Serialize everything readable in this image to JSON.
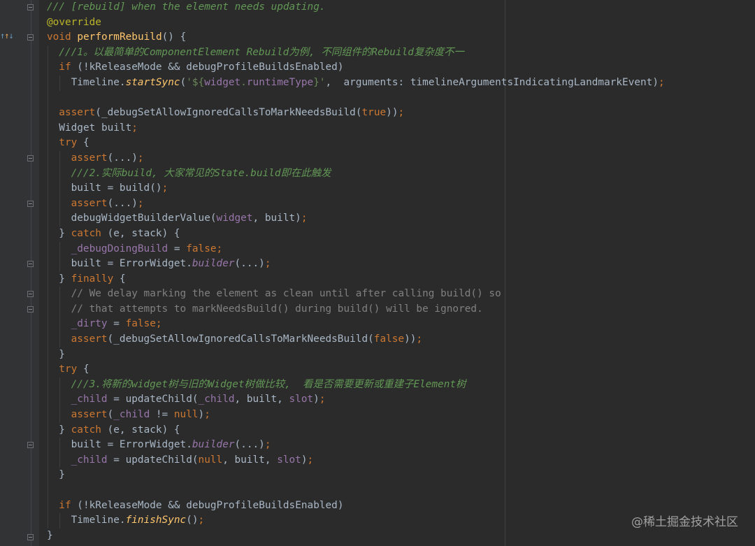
{
  "editor": {
    "language": "dart",
    "theme_colors": {
      "background": "#2b2b2b",
      "keyword": "#cc7832",
      "function": "#ffc66d",
      "property": "#9876aa",
      "string": "#6a8759",
      "comment": "#808080",
      "doc_comment": "#629755",
      "annotation": "#bbb529",
      "default": "#a9b7c6"
    },
    "lines": [
      {
        "indent": 0,
        "tokens": [
          {
            "t": "/// [rebuild] when the element needs updating.",
            "c": "doc"
          }
        ]
      },
      {
        "indent": 0,
        "tokens": [
          {
            "t": "@override",
            "c": "an"
          }
        ]
      },
      {
        "indent": 0,
        "tokens": [
          {
            "t": "void ",
            "c": "kw"
          },
          {
            "t": "performRebuild",
            "c": "fn"
          },
          {
            "t": "() {",
            "c": ""
          }
        ]
      },
      {
        "indent": 1,
        "tokens": [
          {
            "t": "///1。以最简单的ComponentElement Rebuild为例, 不同组件的Rebuild复杂度不一",
            "c": "doc"
          }
        ]
      },
      {
        "indent": 1,
        "tokens": [
          {
            "t": "if ",
            "c": "kw"
          },
          {
            "t": "(!kReleaseMode && debugProfileBuildsEnabled)",
            "c": ""
          }
        ]
      },
      {
        "indent": 2,
        "tokens": [
          {
            "t": "Timeline.",
            "c": ""
          },
          {
            "t": "startSync",
            "c": "it"
          },
          {
            "t": "(",
            "c": ""
          },
          {
            "t": "'${",
            "c": "st"
          },
          {
            "t": "widget",
            "c": "pr"
          },
          {
            "t": ".",
            "c": "st"
          },
          {
            "t": "runtimeType",
            "c": "pr"
          },
          {
            "t": "}'",
            "c": "st"
          },
          {
            "t": ",  arguments: timelineArgumentsIndicatingLandmarkEvent)",
            "c": ""
          },
          {
            "t": ";",
            "c": "kw"
          }
        ]
      },
      {
        "indent": 1,
        "tokens": []
      },
      {
        "indent": 1,
        "tokens": [
          {
            "t": "assert",
            "c": "kw"
          },
          {
            "t": "(_debugSetAllowIgnoredCallsToMarkNeedsBuild(",
            "c": ""
          },
          {
            "t": "true",
            "c": "kw"
          },
          {
            "t": "))",
            "c": ""
          },
          {
            "t": ";",
            "c": "kw"
          }
        ]
      },
      {
        "indent": 1,
        "tokens": [
          {
            "t": "Widget built",
            "c": ""
          },
          {
            "t": ";",
            "c": "kw"
          }
        ]
      },
      {
        "indent": 1,
        "tokens": [
          {
            "t": "try ",
            "c": "kw"
          },
          {
            "t": "{",
            "c": ""
          }
        ]
      },
      {
        "indent": 2,
        "tokens": [
          {
            "t": "assert",
            "c": "kw"
          },
          {
            "t": "(...)",
            "c": ""
          },
          {
            "t": ";",
            "c": "kw"
          }
        ]
      },
      {
        "indent": 2,
        "tokens": [
          {
            "t": "///2.实际build, 大家常见的State.build即在此触发",
            "c": "doc"
          }
        ]
      },
      {
        "indent": 2,
        "tokens": [
          {
            "t": "built = build()",
            "c": ""
          },
          {
            "t": ";",
            "c": "kw"
          }
        ]
      },
      {
        "indent": 2,
        "tokens": [
          {
            "t": "assert",
            "c": "kw"
          },
          {
            "t": "(...)",
            "c": ""
          },
          {
            "t": ";",
            "c": "kw"
          }
        ]
      },
      {
        "indent": 2,
        "tokens": [
          {
            "t": "debugWidgetBuilderValue(",
            "c": ""
          },
          {
            "t": "widget",
            "c": "pr"
          },
          {
            "t": ", built)",
            "c": ""
          },
          {
            "t": ";",
            "c": "kw"
          }
        ]
      },
      {
        "indent": 1,
        "tokens": [
          {
            "t": "} ",
            "c": ""
          },
          {
            "t": "catch ",
            "c": "kw"
          },
          {
            "t": "(e, stack) {",
            "c": ""
          }
        ]
      },
      {
        "indent": 2,
        "tokens": [
          {
            "t": "_debugDoingBuild",
            "c": "pr"
          },
          {
            "t": " = ",
            "c": ""
          },
          {
            "t": "false",
            "c": "kw"
          },
          {
            "t": ";",
            "c": "kw"
          }
        ]
      },
      {
        "indent": 2,
        "tokens": [
          {
            "t": "built = ErrorWidget.",
            "c": ""
          },
          {
            "t": "builder",
            "c": "pi"
          },
          {
            "t": "(...)",
            "c": ""
          },
          {
            "t": ";",
            "c": "kw"
          }
        ]
      },
      {
        "indent": 1,
        "tokens": [
          {
            "t": "} ",
            "c": ""
          },
          {
            "t": "finally ",
            "c": "kw"
          },
          {
            "t": "{",
            "c": ""
          }
        ]
      },
      {
        "indent": 2,
        "tokens": [
          {
            "t": "// We delay marking the element as clean until after calling build() so",
            "c": "cm"
          }
        ]
      },
      {
        "indent": 2,
        "tokens": [
          {
            "t": "// that attempts to markNeedsBuild() during build() will be ignored.",
            "c": "cm"
          }
        ]
      },
      {
        "indent": 2,
        "tokens": [
          {
            "t": "_dirty",
            "c": "pr"
          },
          {
            "t": " = ",
            "c": ""
          },
          {
            "t": "false",
            "c": "kw"
          },
          {
            "t": ";",
            "c": "kw"
          }
        ]
      },
      {
        "indent": 2,
        "tokens": [
          {
            "t": "assert",
            "c": "kw"
          },
          {
            "t": "(_debugSetAllowIgnoredCallsToMarkNeedsBuild(",
            "c": ""
          },
          {
            "t": "false",
            "c": "kw"
          },
          {
            "t": "))",
            "c": ""
          },
          {
            "t": ";",
            "c": "kw"
          }
        ]
      },
      {
        "indent": 1,
        "tokens": [
          {
            "t": "}",
            "c": ""
          }
        ]
      },
      {
        "indent": 1,
        "tokens": [
          {
            "t": "try ",
            "c": "kw"
          },
          {
            "t": "{",
            "c": ""
          }
        ]
      },
      {
        "indent": 2,
        "tokens": [
          {
            "t": "///3.将新的widget树与旧的Widget树做比较,  看是否需要更新或重建子Element树",
            "c": "doc"
          }
        ]
      },
      {
        "indent": 2,
        "tokens": [
          {
            "t": "_child",
            "c": "pr"
          },
          {
            "t": " = updateChild(",
            "c": ""
          },
          {
            "t": "_child",
            "c": "pr"
          },
          {
            "t": ", built, ",
            "c": ""
          },
          {
            "t": "slot",
            "c": "pr"
          },
          {
            "t": ")",
            "c": ""
          },
          {
            "t": ";",
            "c": "kw"
          }
        ]
      },
      {
        "indent": 2,
        "tokens": [
          {
            "t": "assert",
            "c": "kw"
          },
          {
            "t": "(",
            "c": ""
          },
          {
            "t": "_child",
            "c": "pr"
          },
          {
            "t": " != ",
            "c": ""
          },
          {
            "t": "null",
            "c": "kw"
          },
          {
            "t": ")",
            "c": ""
          },
          {
            "t": ";",
            "c": "kw"
          }
        ]
      },
      {
        "indent": 1,
        "tokens": [
          {
            "t": "} ",
            "c": ""
          },
          {
            "t": "catch ",
            "c": "kw"
          },
          {
            "t": "(e, stack) {",
            "c": ""
          }
        ]
      },
      {
        "indent": 2,
        "tokens": [
          {
            "t": "built = ErrorWidget.",
            "c": ""
          },
          {
            "t": "builder",
            "c": "pi"
          },
          {
            "t": "(...)",
            "c": ""
          },
          {
            "t": ";",
            "c": "kw"
          }
        ]
      },
      {
        "indent": 2,
        "tokens": [
          {
            "t": "_child",
            "c": "pr"
          },
          {
            "t": " = updateChild(",
            "c": ""
          },
          {
            "t": "null",
            "c": "kw"
          },
          {
            "t": ", built, ",
            "c": ""
          },
          {
            "t": "slot",
            "c": "pr"
          },
          {
            "t": ")",
            "c": ""
          },
          {
            "t": ";",
            "c": "kw"
          }
        ]
      },
      {
        "indent": 1,
        "tokens": [
          {
            "t": "}",
            "c": ""
          }
        ]
      },
      {
        "indent": 1,
        "tokens": []
      },
      {
        "indent": 1,
        "tokens": [
          {
            "t": "if ",
            "c": "kw"
          },
          {
            "t": "(!kReleaseMode && debugProfileBuildsEnabled)",
            "c": ""
          }
        ]
      },
      {
        "indent": 2,
        "tokens": [
          {
            "t": "Timeline.",
            "c": ""
          },
          {
            "t": "finishSync",
            "c": "it"
          },
          {
            "t": "()",
            "c": ""
          },
          {
            "t": ";",
            "c": "kw"
          }
        ]
      },
      {
        "indent": 0,
        "tokens": [
          {
            "t": "}",
            "c": ""
          }
        ]
      }
    ]
  },
  "gutter": {
    "override_marker_icon": "override-method-icon",
    "fold_icon": "fold-toggle-icon"
  },
  "watermark": {
    "text": "@稀土掘金技术社区"
  }
}
